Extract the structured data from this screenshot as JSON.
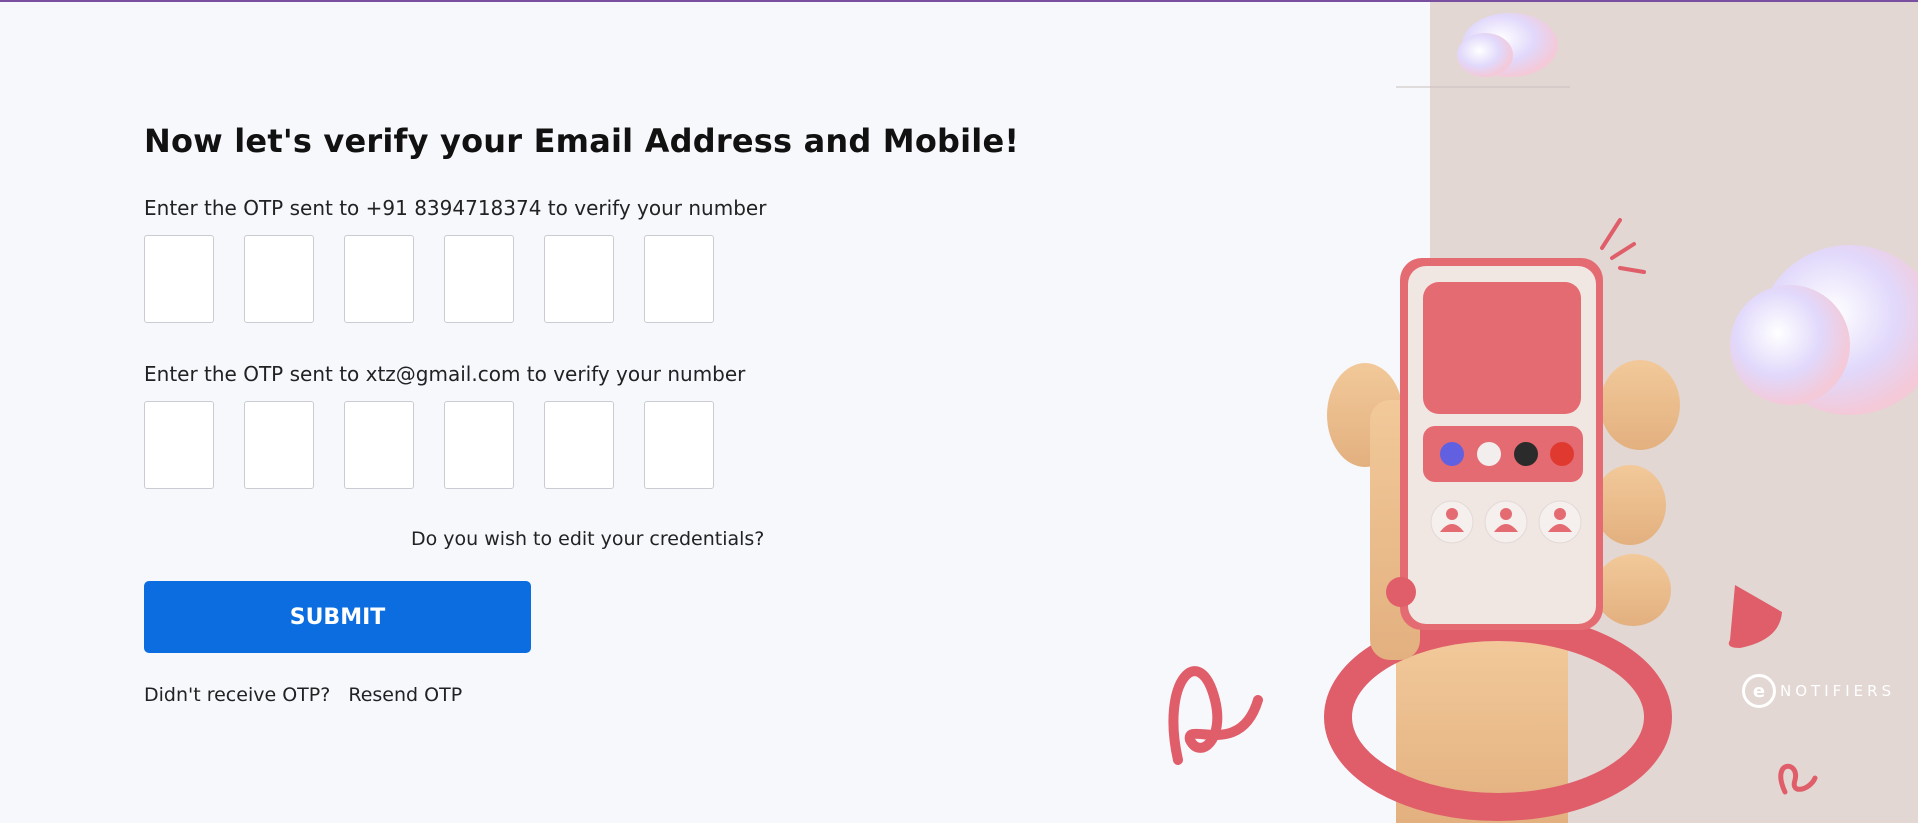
{
  "heading": "Now let's verify your Email Address and Mobile!",
  "phone_otp": {
    "label": "Enter the OTP sent to +91 8394718374 to verify your number",
    "digits": [
      "",
      "",
      "",
      "",
      "",
      ""
    ]
  },
  "email_otp": {
    "label": "Enter the OTP sent to xtz@gmail.com to verify your number",
    "digits": [
      "",
      "",
      "",
      "",
      "",
      ""
    ]
  },
  "edit_credentials": "Do you wish to edit your credentials?",
  "submit_label": "SUBMIT",
  "resend": {
    "prompt": "Didn't receive OTP?",
    "link": "Resend OTP"
  },
  "brand": {
    "logo_letter": "e",
    "name": "NOTIFIERS"
  },
  "colors": {
    "accent": "#0b6ddf",
    "top_border": "#7a4fa0",
    "panel_bg": "#e2d7d3",
    "phone_red": "#e56b73",
    "hand": "#edc08e"
  },
  "illustration": {
    "name": "hand-holding-phone",
    "dot_colors": [
      "#6060e0",
      "#f2eeee",
      "#2b2b2b",
      "#e03a30"
    ]
  }
}
